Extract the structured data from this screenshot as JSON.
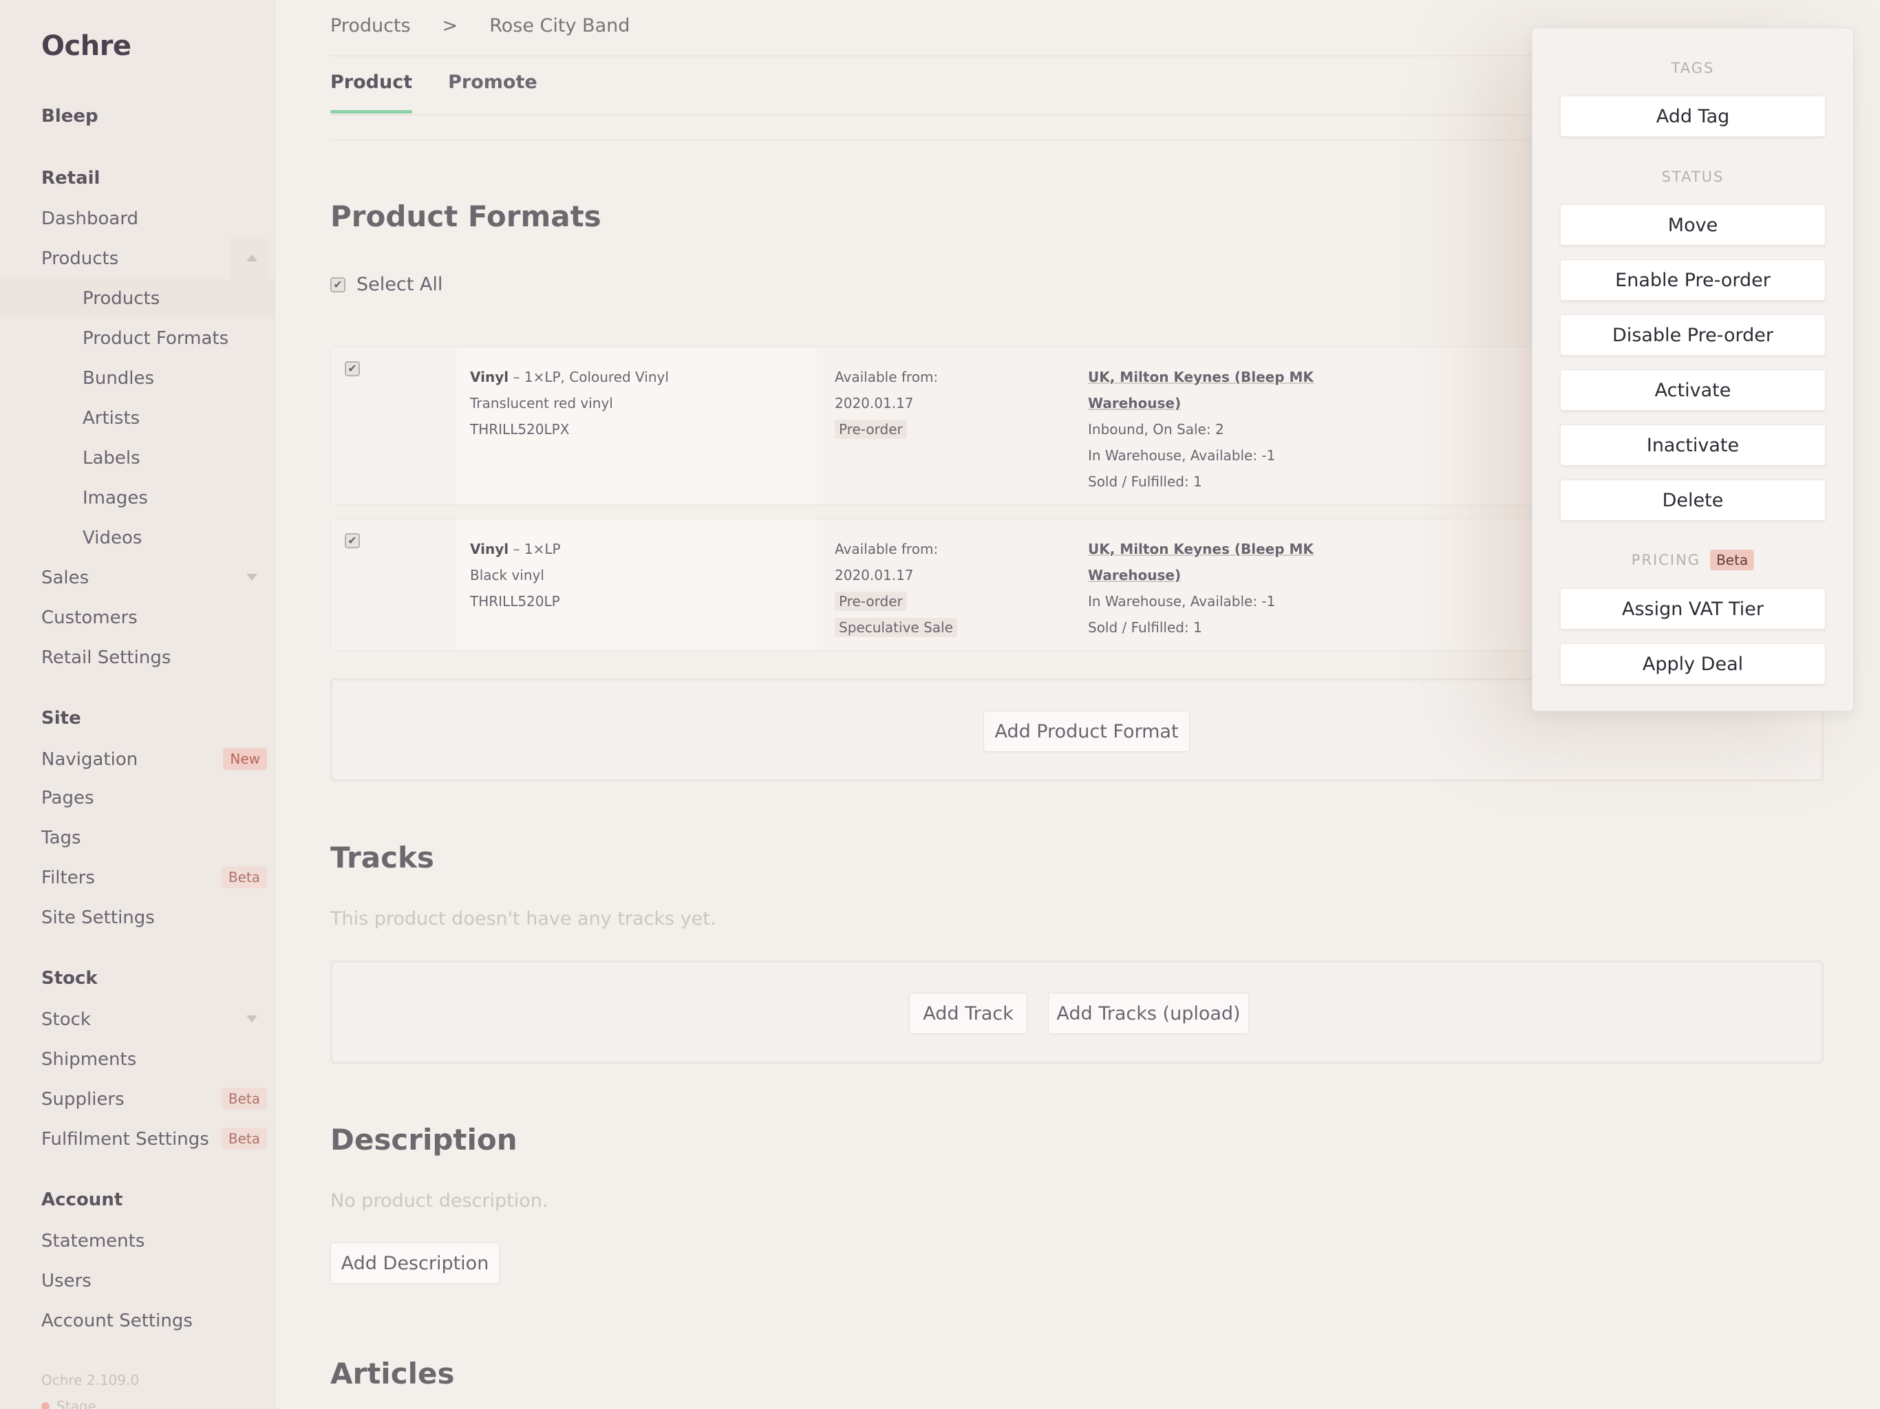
{
  "sidebar": {
    "brand": "Ochre",
    "section_bleep": "Bleep",
    "section_retail": "Retail",
    "retail": {
      "dashboard": "Dashboard",
      "products": "Products",
      "products_sub": [
        "Products",
        "Product Formats",
        "Bundles",
        "Artists",
        "Labels",
        "Images",
        "Videos"
      ],
      "sales": "Sales",
      "customers": "Customers",
      "settings": "Retail Settings"
    },
    "section_site": "Site",
    "site": {
      "navigation": "Navigation",
      "navigation_badge": "New",
      "pages": "Pages",
      "tags": "Tags",
      "filters": "Filters",
      "filters_badge": "Beta",
      "settings": "Site Settings"
    },
    "section_stock": "Stock",
    "stock": {
      "stock": "Stock",
      "shipments": "Shipments",
      "suppliers": "Suppliers",
      "suppliers_badge": "Beta",
      "fulfilment": "Fulfilment Settings",
      "fulfilment_badge": "Beta"
    },
    "section_account": "Account",
    "account": {
      "statements": "Statements",
      "users": "Users",
      "settings": "Account Settings"
    },
    "version": "Ochre 2.109.0",
    "stage": "Stage"
  },
  "main": {
    "breadcrumb": [
      "Products",
      ">",
      "Rose City Band"
    ],
    "tabs": [
      "Product",
      "Promote"
    ],
    "product_formats_title": "Product Formats",
    "select_all": "Select All",
    "formats": [
      {
        "format": "Vinyl",
        "detail": " – 1×LP, Coloured Vinyl",
        "description": "Translucent red vinyl",
        "sku": "THRILL520LPX",
        "available_label": "Available from:",
        "available_date": "2020.01.17",
        "tags": [
          "Pre-order"
        ],
        "location_line1": "UK, Milton Keynes (Bleep MK",
        "location_line2": "Warehouse)",
        "stock_lines": [
          "Inbound, On Sale: 2",
          "In Warehouse, Available: -1",
          "Sold / Fulfilled: 1"
        ]
      },
      {
        "format": "Vinyl",
        "detail": " – 1×LP",
        "description": "Black vinyl",
        "sku": "THRILL520LP",
        "available_label": "Available from:",
        "available_date": "2020.01.17",
        "tags": [
          "Pre-order",
          "Speculative Sale"
        ],
        "location_line1": "UK, Milton Keynes (Bleep MK",
        "location_line2": "Warehouse)",
        "stock_lines": [
          "In Warehouse, Available: -1",
          "Sold / Fulfilled: 1"
        ]
      }
    ],
    "add_product_format": "Add Product Format",
    "tracks_title": "Tracks",
    "tracks_empty": "This product doesn't have any tracks yet.",
    "add_track": "Add Track",
    "add_tracks_upload": "Add Tracks (upload)",
    "description_title": "Description",
    "description_empty": "No product description.",
    "add_description": "Add Description",
    "articles_title": "Articles"
  },
  "popover": {
    "tags_label": "TAGS",
    "add_tag": "Add Tag",
    "status_label": "STATUS",
    "status_actions": [
      "Move",
      "Enable Pre-order",
      "Disable Pre-order",
      "Activate",
      "Inactivate",
      "Delete"
    ],
    "pricing_label": "PRICING",
    "pricing_badge": "Beta",
    "pricing_actions": [
      "Assign VAT Tier",
      "Apply Deal"
    ]
  },
  "colors": {
    "accent_tab": "#8fd1a6",
    "badge_new": "#f3cfc9",
    "badge_beta": "#f2c7c0"
  }
}
